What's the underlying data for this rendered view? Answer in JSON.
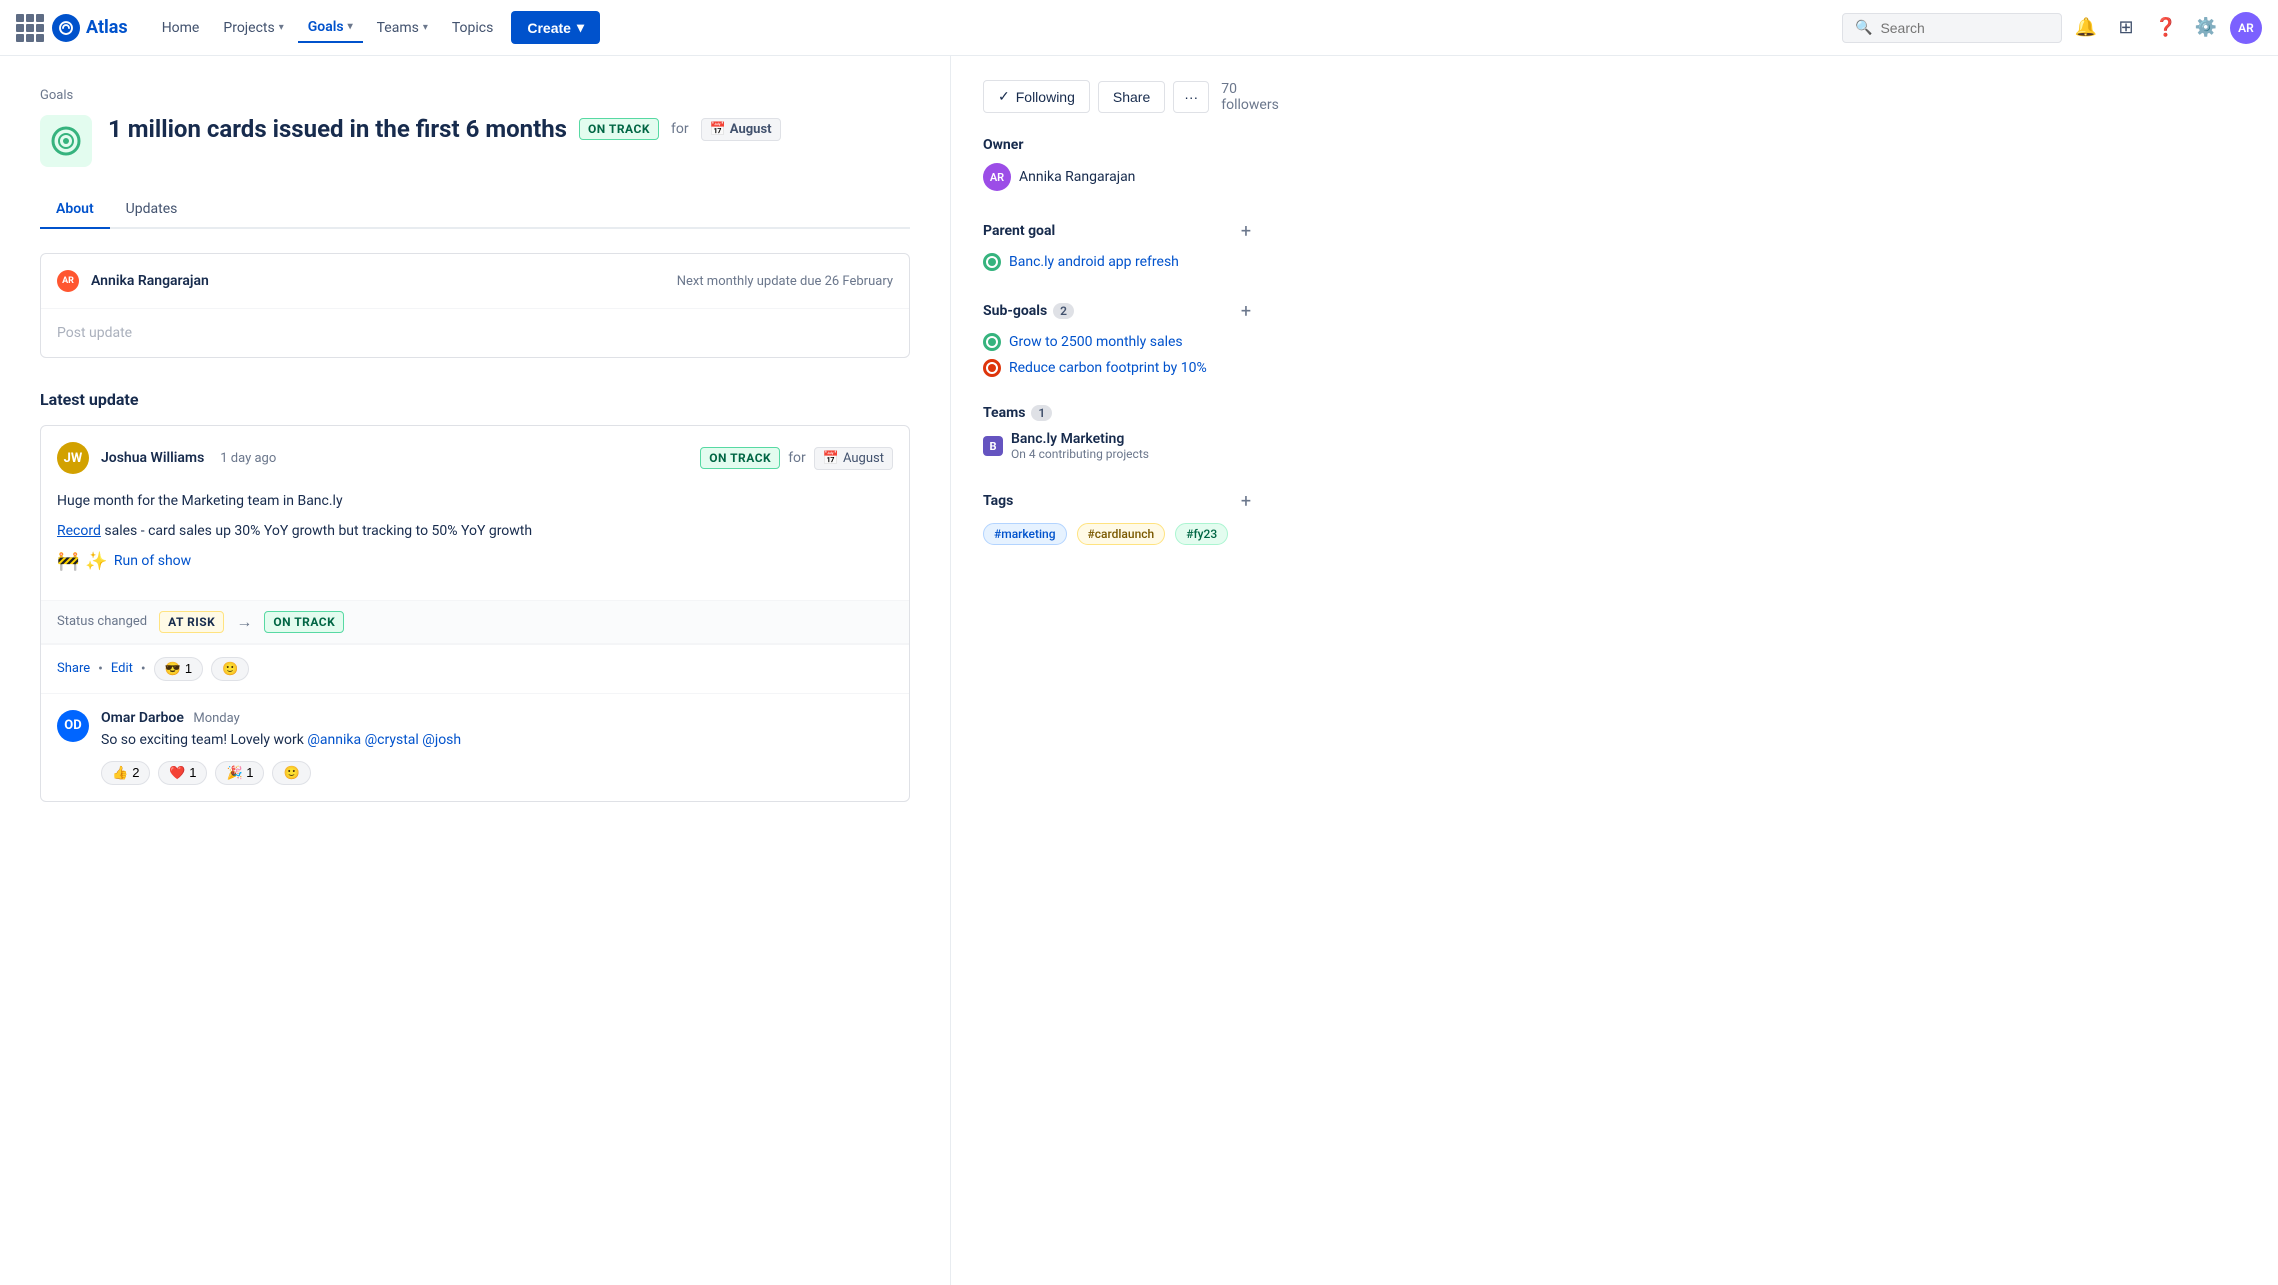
{
  "nav": {
    "logo_text": "Atlas",
    "items": [
      {
        "label": "Home",
        "active": false
      },
      {
        "label": "Projects",
        "active": false,
        "has_chevron": true
      },
      {
        "label": "Goals",
        "active": true,
        "has_chevron": true
      },
      {
        "label": "Teams",
        "active": false,
        "has_chevron": true
      },
      {
        "label": "Topics",
        "active": false
      }
    ],
    "create_label": "Create",
    "search_placeholder": "Search"
  },
  "breadcrumb": "Goals",
  "goal": {
    "title": "1 million cards issued in the first 6 months",
    "status": "ON TRACK",
    "for_text": "for",
    "month": "August",
    "tabs": [
      "About",
      "Updates"
    ]
  },
  "post_update": {
    "author_name": "Annika Rangarajan",
    "placeholder": "Post update",
    "due_text": "Next monthly update due 26 February"
  },
  "latest_update": {
    "section_title": "Latest update",
    "author": "Joshua Williams",
    "time": "1 day ago",
    "status": "ON TRACK",
    "for_text": "for",
    "month": "August",
    "text_line1": "Huge month for the Marketing team in Banc.ly",
    "text_line2_prefix": "",
    "text_link": "Record",
    "text_line2_suffix": " sales - card sales up 30% YoY growth but tracking to 50% YoY growth",
    "run_of_show_label": "Run of show",
    "status_change_label": "Status changed",
    "status_from": "AT RISK",
    "status_to": "ON TRACK",
    "footer_share": "Share",
    "footer_edit": "Edit",
    "reaction_cool": "😎",
    "reaction_cool_count": "1",
    "reaction_emoji_btn": "🙂",
    "comment_author": "Omar Darboe",
    "comment_time": "Monday",
    "comment_text": "So so exciting team! Lovely work",
    "mention1": "@annika",
    "mention2": "@crystal",
    "mention3": "@josh",
    "comment_reactions": [
      "2",
      "❤️ 1",
      "🎉 1"
    ]
  },
  "sidebar": {
    "action_following": "Following",
    "action_share": "Share",
    "action_more": "···",
    "followers_text": "70 followers",
    "owner_label": "Owner",
    "owner_name": "Annika Rangarajan",
    "parent_goal_label": "Parent goal",
    "parent_goal_name": "Banc.ly android app refresh",
    "sub_goals_label": "Sub-goals",
    "sub_goals_count": "2",
    "sub_goals": [
      {
        "name": "Grow to 2500 monthly sales",
        "color": "green"
      },
      {
        "name": "Reduce carbon footprint by 10%",
        "color": "red"
      }
    ],
    "teams_label": "Teams",
    "teams_count": "1",
    "team_name": "Banc.ly Marketing",
    "team_sub": "On 4 contributing projects",
    "tags_label": "Tags",
    "tags": [
      {
        "text": "#marketing",
        "style": "blue"
      },
      {
        "text": "#cardlaunch",
        "style": "yellow"
      },
      {
        "text": "#fy23",
        "style": "green"
      }
    ]
  }
}
